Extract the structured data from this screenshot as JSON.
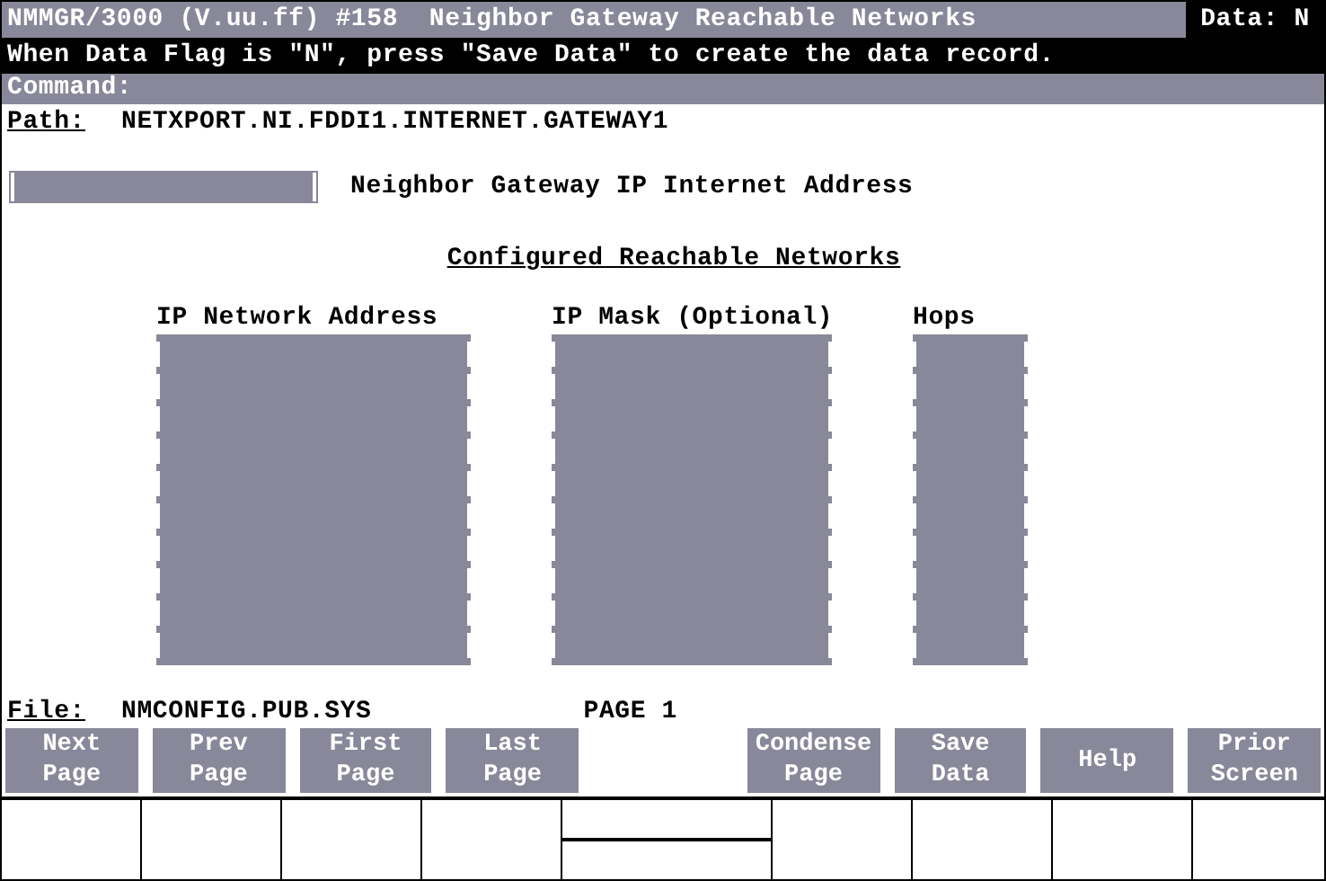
{
  "window": {
    "title": "NMMGR/3000 (V.uu.ff) #158  Neighbor Gateway Reachable Networks",
    "data_flag": "Data: N"
  },
  "message": "When Data Flag is \"N\", press \"Save Data\" to create the data record.",
  "command": {
    "label": "Command:"
  },
  "path": {
    "label": "Path:",
    "value": "NETXPORT.NI.FDDI1.INTERNET.GATEWAY1"
  },
  "gateway_field": {
    "label": "Neighbor Gateway IP Internet Address"
  },
  "section": {
    "heading": "Configured Reachable Networks"
  },
  "table": {
    "columns": [
      {
        "label": "IP Network Address",
        "kind": "wide"
      },
      {
        "label": "IP Mask (Optional)",
        "kind": "medium"
      },
      {
        "label": "Hops",
        "kind": "narrow"
      }
    ],
    "rows": [
      {
        "kind": "empty"
      },
      {
        "kind": "empty"
      },
      {
        "kind": "empty"
      },
      {
        "kind": "empty"
      },
      {
        "kind": "empty"
      },
      {
        "kind": "empty"
      },
      {
        "kind": "empty"
      },
      {
        "kind": "empty"
      },
      {
        "kind": "empty"
      },
      {
        "kind": "empty"
      }
    ]
  },
  "file": {
    "label": "File:",
    "value": "NMCONFIG.PUB.SYS",
    "page": "PAGE 1"
  },
  "function_keys": [
    {
      "kind": "key",
      "lines": [
        "Next",
        "Page"
      ]
    },
    {
      "kind": "key",
      "lines": [
        "Prev",
        "Page"
      ]
    },
    {
      "kind": "key",
      "lines": [
        "First",
        "Page"
      ]
    },
    {
      "kind": "key",
      "lines": [
        "Last",
        "Page"
      ]
    },
    {
      "kind": "blank"
    },
    {
      "kind": "key",
      "lines": [
        "Condense",
        "Page"
      ]
    },
    {
      "kind": "key",
      "lines": [
        "Save",
        "Data"
      ]
    },
    {
      "kind": "key",
      "lines": [
        "Help"
      ]
    },
    {
      "kind": "key",
      "lines": [
        "Prior",
        "Screen"
      ]
    }
  ]
}
